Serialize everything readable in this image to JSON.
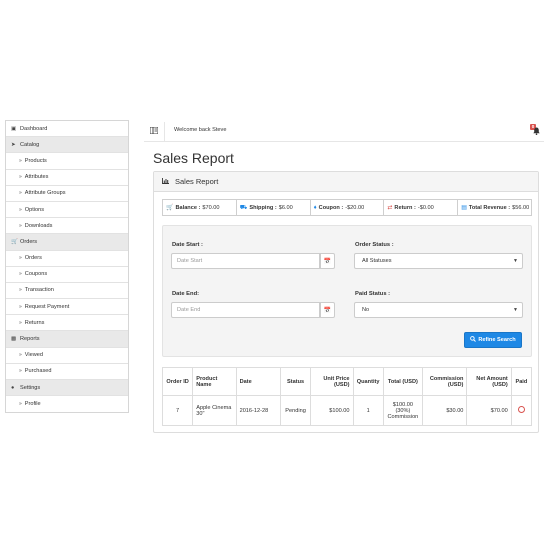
{
  "sidebar": {
    "items": [
      {
        "label": "Dashboard",
        "type": "plain",
        "icon": "dashboard-icon"
      },
      {
        "label": "Catalog",
        "type": "head",
        "icon": "tags-icon"
      },
      {
        "label": "Products",
        "type": "sub"
      },
      {
        "label": "Attributes",
        "type": "sub"
      },
      {
        "label": "Attribute Groups",
        "type": "sub"
      },
      {
        "label": "Options",
        "type": "sub"
      },
      {
        "label": "Downloads",
        "type": "sub"
      },
      {
        "label": "Orders",
        "type": "head",
        "icon": "cart-icon"
      },
      {
        "label": "Orders",
        "type": "sub"
      },
      {
        "label": "Coupons",
        "type": "sub"
      },
      {
        "label": "Transaction",
        "type": "sub"
      },
      {
        "label": "Request Payment",
        "type": "sub"
      },
      {
        "label": "Returns",
        "type": "sub"
      },
      {
        "label": "Reports",
        "type": "head",
        "icon": "bar-chart-icon"
      },
      {
        "label": "Viewed",
        "type": "sub"
      },
      {
        "label": "Purchased",
        "type": "sub"
      },
      {
        "label": "Settings",
        "type": "head",
        "icon": "user-icon"
      },
      {
        "label": "Profile",
        "type": "sub"
      }
    ],
    "sub_caret": "»"
  },
  "topbar": {
    "welcome": "Welcome back Steve",
    "notification_count": "0"
  },
  "page": {
    "title": "Sales Report",
    "panel_title": "Sales Report"
  },
  "summary": {
    "balance_label": "Balance :",
    "balance_value": "$70.00",
    "shipping_label": "Shipping :",
    "shipping_value": "$6.00",
    "coupon_label": "Coupon :",
    "coupon_value": "-$20.00",
    "return_label": "Return :",
    "return_value": "-$0.00",
    "revenue_label": "Total Revenue :",
    "revenue_value": "$56.00"
  },
  "filter": {
    "date_start_label": "Date Start :",
    "date_start_placeholder": "Date Start",
    "order_status_label": "Order Status :",
    "order_status_value": "All Statuses",
    "date_end_label": "Date End:",
    "date_end_placeholder": "Date End",
    "paid_status_label": "Paid Status :",
    "paid_status_value": "No",
    "refine_label": "Refine Search"
  },
  "table": {
    "headers": {
      "order_id": "Order ID",
      "product_name": "Product Name",
      "date": "Date",
      "status": "Status",
      "unit_price": "Unit Price (USD)",
      "quantity": "Quantity",
      "total": "Total (USD)",
      "commission": "Commission (USD)",
      "net_amount": "Net Amount (USD)",
      "paid": "Paid"
    },
    "rows": [
      {
        "order_id": "7",
        "product_name": "Apple Cinema 30\"",
        "date": "2016-12-28",
        "status": "Pending",
        "unit_price": "$100.00",
        "quantity": "1",
        "total_line1": "$100.00",
        "total_line2": "(30%)",
        "total_line3": "Commission",
        "commission": "$30.00",
        "net_amount": "$70.00"
      }
    ]
  },
  "colors": {
    "accent": "#1e88e5",
    "danger": "#d9534f",
    "sidebar_head_bg": "#e9e9e9"
  }
}
